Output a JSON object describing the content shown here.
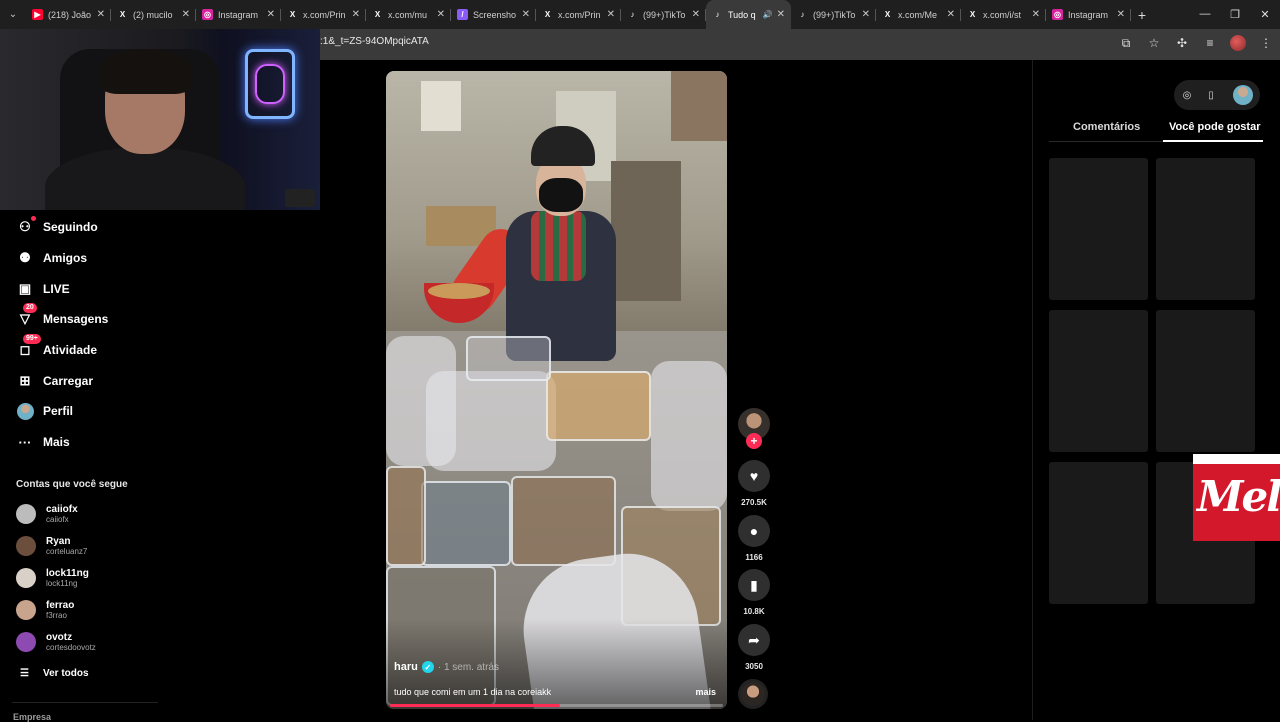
{
  "browser": {
    "tabs": [
      {
        "title": "(218) João",
        "icon": "youtube-icon",
        "color": "#ff0033",
        "glyph": "▶"
      },
      {
        "title": "(2) mucilo",
        "icon": "x-icon",
        "color": "#1f1f1f",
        "glyph": "X"
      },
      {
        "title": "Instagram",
        "icon": "instagram-icon",
        "color": "#d6249f",
        "glyph": "◎"
      },
      {
        "title": "x.com/Prin",
        "icon": "x-icon",
        "color": "#1f1f1f",
        "glyph": "X"
      },
      {
        "title": "x.com/mu",
        "icon": "x-icon",
        "color": "#1f1f1f",
        "glyph": "X"
      },
      {
        "title": "Screensho",
        "icon": "screenshot-icon",
        "color": "#8a5cf5",
        "glyph": "/"
      },
      {
        "title": "x.com/Prin",
        "icon": "x-icon",
        "color": "#1f1f1f",
        "glyph": "X"
      },
      {
        "title": "(99+)TikTo",
        "icon": "tiktok-icon",
        "color": "#1f1f1f",
        "glyph": "♪"
      },
      {
        "title": "Tudo q",
        "icon": "tiktok-icon",
        "color": "#3a3a3a",
        "glyph": "♪",
        "active": true,
        "audio": "🔊"
      },
      {
        "title": "(99+)TikTo",
        "icon": "tiktok-icon",
        "color": "#1f1f1f",
        "glyph": "♪"
      },
      {
        "title": "x.com/Me",
        "icon": "x-icon",
        "color": "#1f1f1f",
        "glyph": "X"
      },
      {
        "title": "x.com/i/st",
        "icon": "x-icon",
        "color": "#1f1f1f",
        "glyph": "X"
      },
      {
        "title": "Instagram",
        "icon": "instagram-icon",
        "color": "#d6249f",
        "glyph": "◎"
      }
    ],
    "url_fragment": ":1&_t=ZS-94OMpqicATA"
  },
  "nav": {
    "items": [
      {
        "label": "Seguindo",
        "icon": "person-plus-icon",
        "glyph": "⚇"
      },
      {
        "label": "Amigos",
        "icon": "friends-icon",
        "glyph": "⚉"
      },
      {
        "label": "LIVE",
        "icon": "live-icon",
        "glyph": "▣"
      },
      {
        "label": "Mensagens",
        "icon": "message-icon",
        "glyph": "▽",
        "badge": "20"
      },
      {
        "label": "Atividade",
        "icon": "activity-icon",
        "glyph": "◻",
        "badge": "99+"
      },
      {
        "label": "Carregar",
        "icon": "upload-icon",
        "glyph": "⊞"
      },
      {
        "label": "Perfil",
        "icon": "profile-avatar",
        "glyph": ""
      },
      {
        "label": "Mais",
        "icon": "more-icon",
        "glyph": "···"
      }
    ],
    "following_title": "Contas que você segue",
    "accounts": [
      {
        "name": "caiiofx",
        "handle": "caiiofx",
        "color": "#bcbcbc"
      },
      {
        "name": "Ryan",
        "handle": "corteluanz7",
        "color": "#6b4e3c"
      },
      {
        "name": "lock11ng",
        "handle": "lock11ng",
        "color": "#d9d0c8"
      },
      {
        "name": "ferrao",
        "handle": "f3rrao",
        "color": "#c9a48c"
      },
      {
        "name": "ovotz",
        "handle": "cortesdoovotz",
        "color": "#8d4ab0"
      }
    ],
    "see_all": "Ver todos",
    "company": "Empresa"
  },
  "video": {
    "author": "haru",
    "time": "· 1 sem. atrás",
    "description": "tudo que comi em um 1 dia na coreiakk",
    "more": "mais",
    "progress": 0.51
  },
  "actions": {
    "likes": "270.5K",
    "comments": "1166",
    "saves": "10.8K",
    "shares": "3050"
  },
  "right_panel": {
    "tab_comments": "Comentários",
    "tab_suggested": "Você pode gostar",
    "ad_text": "Melitta"
  }
}
